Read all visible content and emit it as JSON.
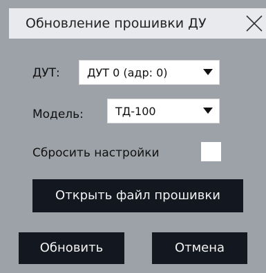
{
  "window": {
    "title": "Обновление прошивки ДУ"
  },
  "dut": {
    "label": "ДУТ:",
    "selected": "ДУТ 0 (адр: 0)"
  },
  "model": {
    "label": "Модель:",
    "selected": "ТД-100"
  },
  "reset": {
    "label": "Сбросить настройки",
    "checked": false
  },
  "buttons": {
    "open_firmware": "Открыть файл прошивки",
    "update": "Обновить",
    "cancel": "Отмена"
  },
  "icons": {
    "close": "close-icon",
    "dropdown": "chevron-down-icon"
  },
  "colors": {
    "background": "#9da2a8",
    "titlebar": "#e8eaed",
    "button": "#13171f",
    "button_text": "#f3f3f3"
  }
}
